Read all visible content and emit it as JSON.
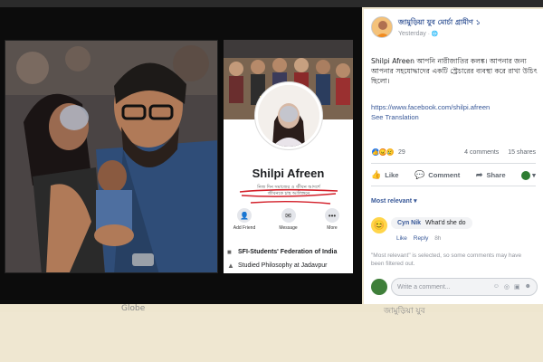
{
  "profile": {
    "name": "Shilpi Afreen",
    "bio_line1": "নিজ দিন সমাজের ও জীবন আদর্শে",
    "bio_line2": "জীবনকে চাহ আলিঙ্গনে",
    "actions": [
      {
        "label": "Add Friend",
        "icon": "add-friend-icon",
        "glyph": "👤"
      },
      {
        "label": "Message",
        "icon": "messenger-icon",
        "glyph": "✉"
      },
      {
        "label": "More",
        "icon": "more-icon",
        "glyph": "•••"
      }
    ],
    "info": [
      {
        "text": "SFI-Students' Federation of India",
        "icon": "briefcase-icon"
      },
      {
        "text": "Studied Philosophy at Jadavpur",
        "icon": "graduation-icon"
      }
    ]
  },
  "post": {
    "page_name": "জামুড়িয়া যুব মোর্চা গ্রামীণ ১",
    "time": "Yesterday",
    "text": "Shilpi Afreen আপনি নারীজাতির কলঙ্ক। আপনার জন্য আপনার সহযোদ্ধাদের একটি স্ট্রেচারের ব্যবস্থা করে রাখা উচিৎ ছিলো।",
    "link": "https://www.facebook.com/shilpi.afreen",
    "see_translation": "See Translation",
    "reaction_count": "29",
    "comments": "4 comments",
    "shares": "15 shares",
    "like_label": "Like",
    "comment_label": "Comment",
    "share_label": "Share",
    "most_relevant": "Most relevant",
    "comment_item": {
      "author": "Cyn Nik",
      "text": "What'd she do",
      "like": "Like",
      "reply": "Reply",
      "time": "8h"
    },
    "note": "\"Most relevant\" is selected, so some comments may have been filtered out.",
    "write_placeholder": "Write a comment..."
  },
  "footer": {
    "left_caption": "Globe",
    "right_caption": "জামুড়িয়া যুব"
  },
  "colors": {
    "facebook_blue": "#385898",
    "like_blue": "#2078f4",
    "scribble_red": "#d3202a"
  }
}
